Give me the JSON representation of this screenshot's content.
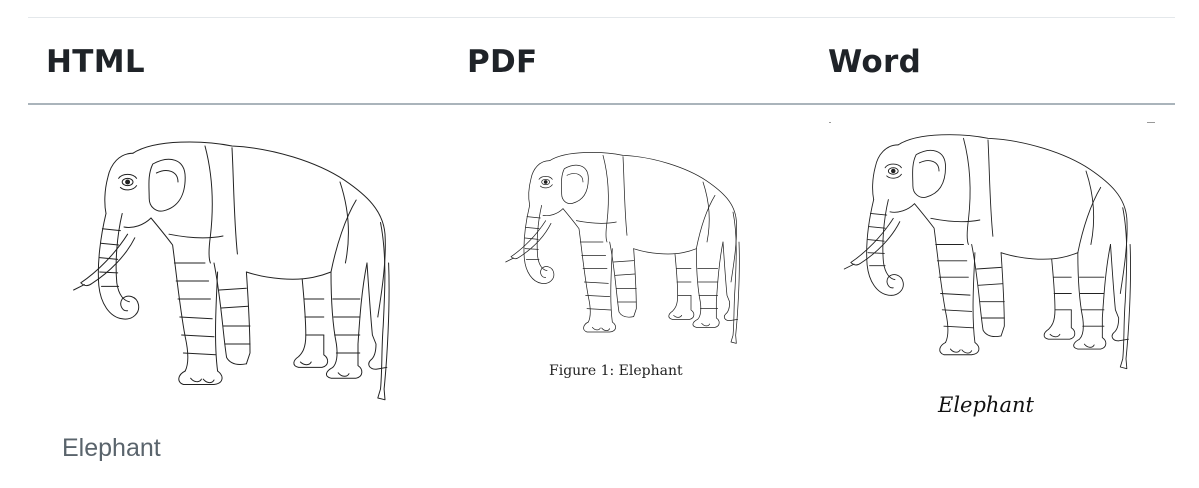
{
  "columns": [
    {
      "heading": "HTML",
      "caption": "Elephant"
    },
    {
      "heading": "PDF",
      "caption": "Figure 1: Elephant"
    },
    {
      "heading": "Word",
      "caption": "Elephant"
    }
  ],
  "figure": {
    "subject": "elephant-line-drawing",
    "stroke_color": "#222222",
    "background_color": "#ffffff"
  },
  "colors": {
    "heading": "#1f2328",
    "html_caption": "#5a646c",
    "header_rule": "#aab4bb",
    "top_rule": "#e4e8eb"
  }
}
